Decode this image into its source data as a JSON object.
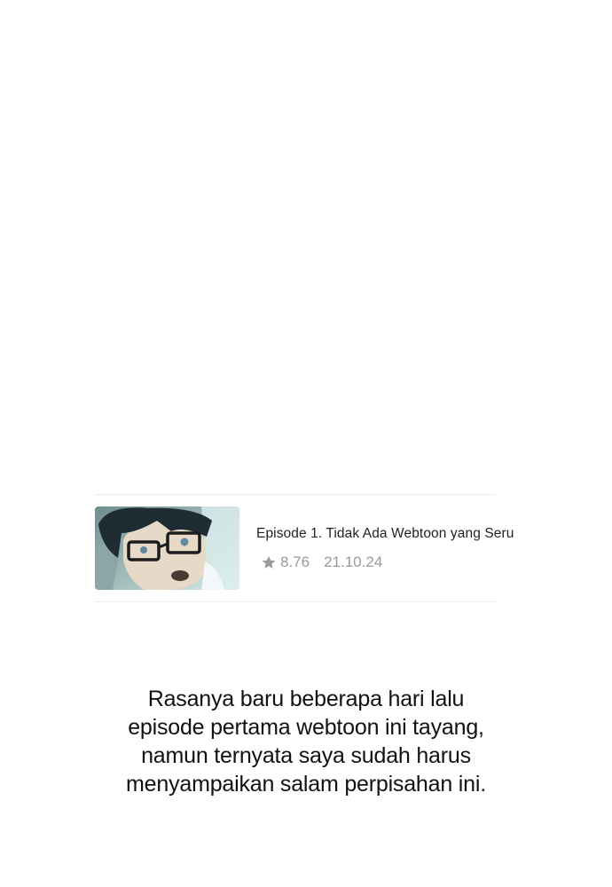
{
  "episode": {
    "title": "Episode 1. Tidak Ada Webtoon yang Seru",
    "rating": "8.76",
    "date": "21.10.24",
    "icon": "star-icon"
  },
  "caption": {
    "lines": [
      "Rasanya baru beberapa hari lalu",
      "episode pertama webtoon ini tayang,",
      "namun ternyata saya sudah harus",
      "menyampaikan salam perpisahan ini."
    ]
  },
  "colors": {
    "meta_text": "#9a9a9a",
    "divider": "#ececec",
    "title_text": "#222222"
  }
}
